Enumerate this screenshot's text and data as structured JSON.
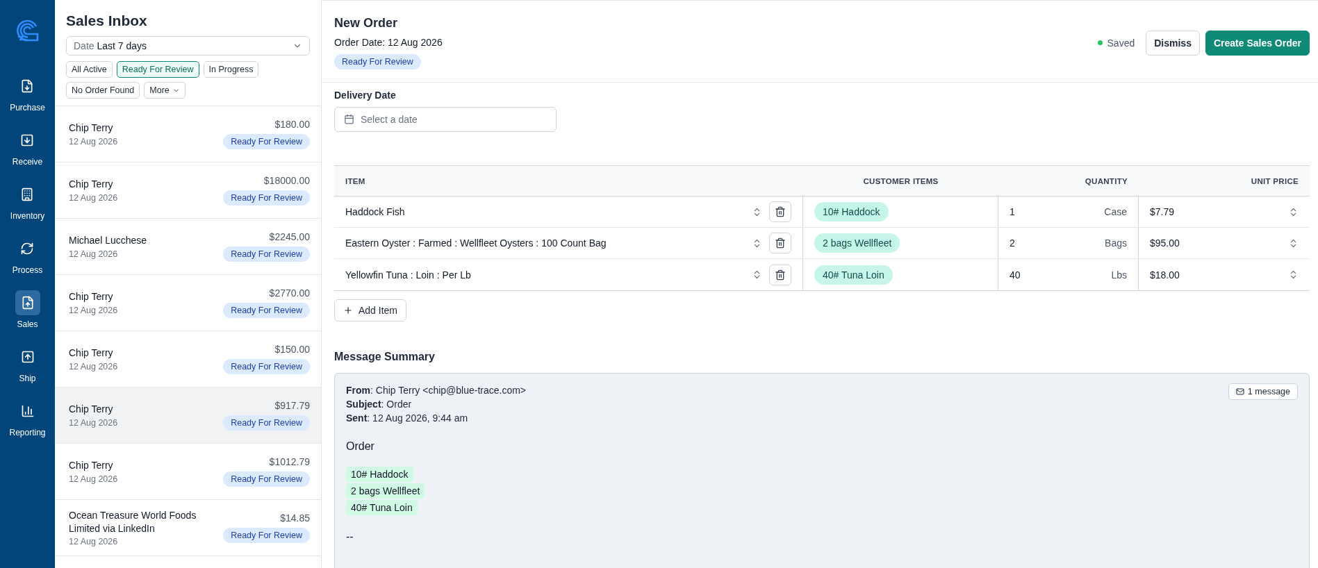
{
  "nav": {
    "items": [
      {
        "label": "Purchase",
        "selected": false
      },
      {
        "label": "Receive",
        "selected": false
      },
      {
        "label": "Inventory",
        "selected": false
      },
      {
        "label": "Process",
        "selected": false
      },
      {
        "label": "Sales",
        "selected": true
      },
      {
        "label": "Ship",
        "selected": false
      },
      {
        "label": "Reporting",
        "selected": false
      }
    ]
  },
  "inbox": {
    "title": "Sales Inbox",
    "date_filter": {
      "label": "Date",
      "value": "Last 7 days"
    },
    "filters": [
      {
        "label": "All Active",
        "selected": false
      },
      {
        "label": "Ready For Review",
        "selected": true
      },
      {
        "label": "In Progress",
        "selected": false
      },
      {
        "label": "No Order Found",
        "selected": false
      }
    ],
    "more_button": "More",
    "rows": [
      {
        "name": "Chip Terry",
        "date": "12 Aug 2026",
        "amount": "$180.00",
        "status": "Ready For Review",
        "selected": false
      },
      {
        "name": "Chip Terry",
        "date": "12 Aug 2026",
        "amount": "$18000.00",
        "status": "Ready For Review",
        "selected": false
      },
      {
        "name": "Michael Lucchese",
        "date": "12 Aug 2026",
        "amount": "$2245.00",
        "status": "Ready For Review",
        "selected": false
      },
      {
        "name": "Chip Terry",
        "date": "12 Aug 2026",
        "amount": "$2770.00",
        "status": "Ready For Review",
        "selected": false
      },
      {
        "name": "Chip Terry",
        "date": "12 Aug 2026",
        "amount": "$150.00",
        "status": "Ready For Review",
        "selected": false
      },
      {
        "name": "Chip Terry",
        "date": "12 Aug 2026",
        "amount": "$917.79",
        "status": "Ready For Review",
        "selected": true
      },
      {
        "name": "Chip Terry",
        "date": "12 Aug 2026",
        "amount": "$1012.79",
        "status": "Ready For Review",
        "selected": false
      },
      {
        "name": "Ocean Treasure World Foods Limited via LinkedIn",
        "date": "12 Aug 2026",
        "amount": "$14.85",
        "status": "Ready For Review",
        "selected": false
      }
    ]
  },
  "order": {
    "title": "New Order",
    "order_date": "Order Date: 12 Aug 2026",
    "status": "Ready For Review",
    "saved": "Saved",
    "dismiss_button": "Dismiss",
    "create_button": "Create Sales Order",
    "delivery": {
      "label": "Delivery Date",
      "placeholder": "Select a date"
    },
    "table": {
      "columns": [
        "ITEM",
        "CUSTOMER ITEMS",
        "QUANTITY",
        "UNIT PRICE"
      ],
      "rows": [
        {
          "item": "Haddock Fish",
          "customer_item": "10# Haddock",
          "quantity": "1",
          "unit": "Case",
          "price": "$7.79"
        },
        {
          "item": "Eastern Oyster : Farmed : Wellfleet Oysters : 100 Count Bag",
          "customer_item": "2 bags Wellfleet",
          "quantity": "2",
          "unit": "Bags",
          "price": "$95.00"
        },
        {
          "item": "Yellowfin Tuna : Loin : Per Lb",
          "customer_item": "40# Tuna Loin",
          "quantity": "40",
          "unit": "Lbs",
          "price": "$18.00"
        }
      ]
    },
    "add_item_button": "Add Item",
    "message": {
      "title": "Message Summary",
      "headers": [
        "**From**: Chip Terry <chip@blue-trace.com>",
        "**Subject**: Order",
        "**Sent**: 12 Aug 2026, 9:44 am"
      ],
      "count_button": "1 message",
      "body_title": "Order",
      "highlights": [
        "10# Haddock",
        "2 bags Wellfleet",
        "40# Tuna Loin"
      ],
      "signature": "--"
    }
  }
}
